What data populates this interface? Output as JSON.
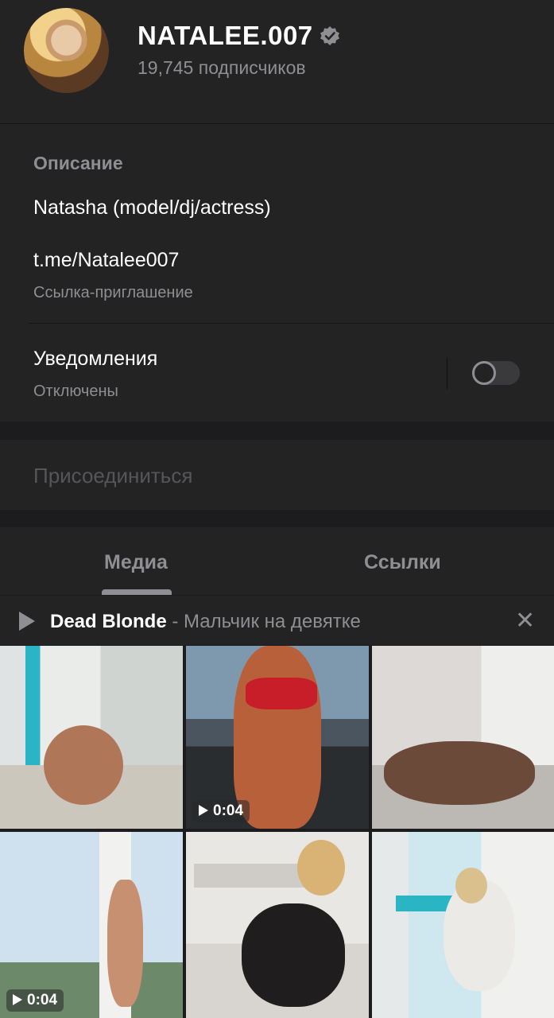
{
  "header": {
    "channel_name": "NATALEE.007",
    "subscribers": "19,745 подписчиков"
  },
  "info": {
    "description_label": "Описание",
    "description": "Natasha (model/dj/actress)",
    "link": "t.me/Natalee007",
    "link_caption": "Ссылка-приглашение",
    "notifications_label": "Уведомления",
    "notifications_status": "Отключены"
  },
  "join": {
    "label": "Присоединиться"
  },
  "tabs": [
    {
      "label": "Медиа",
      "active": true
    },
    {
      "label": "Ссылки",
      "active": false
    }
  ],
  "player": {
    "artist": "Dead Blonde",
    "separator": " - ",
    "title": "Мальчик на девятке"
  },
  "media": [
    {
      "type": "photo",
      "duration": ""
    },
    {
      "type": "video",
      "duration": "0:04"
    },
    {
      "type": "photo",
      "duration": ""
    },
    {
      "type": "video",
      "duration": "0:04"
    },
    {
      "type": "photo",
      "duration": ""
    },
    {
      "type": "photo",
      "duration": ""
    }
  ],
  "colors": {
    "background": "#1c1c1e",
    "panel": "#232323",
    "secondary_text": "#8e8e93"
  }
}
